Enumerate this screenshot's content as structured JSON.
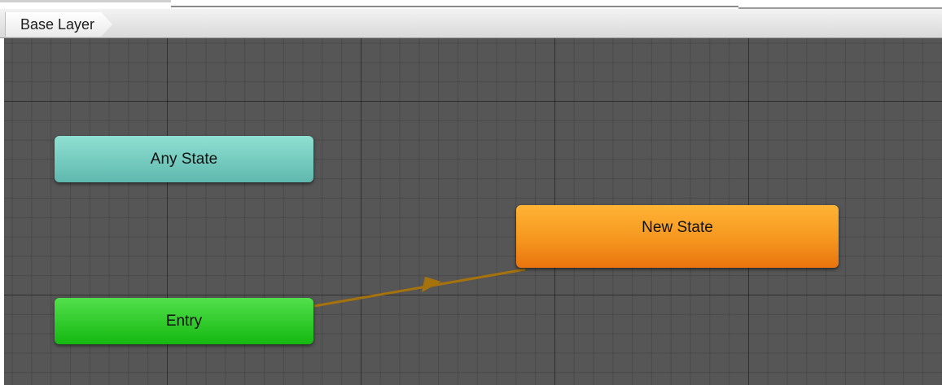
{
  "breadcrumb": {
    "layer_label": "Base Layer"
  },
  "graph": {
    "nodes": {
      "any_state": "Any State",
      "entry": "Entry",
      "new_state": "New State"
    },
    "transition": {
      "from": "Entry",
      "to": "New State"
    }
  },
  "colors": {
    "canvas": "#565656",
    "any_state": "#76cdc2",
    "entry": "#2fcb2a",
    "new_state": "#f5961f",
    "transition": "#a6720c"
  }
}
